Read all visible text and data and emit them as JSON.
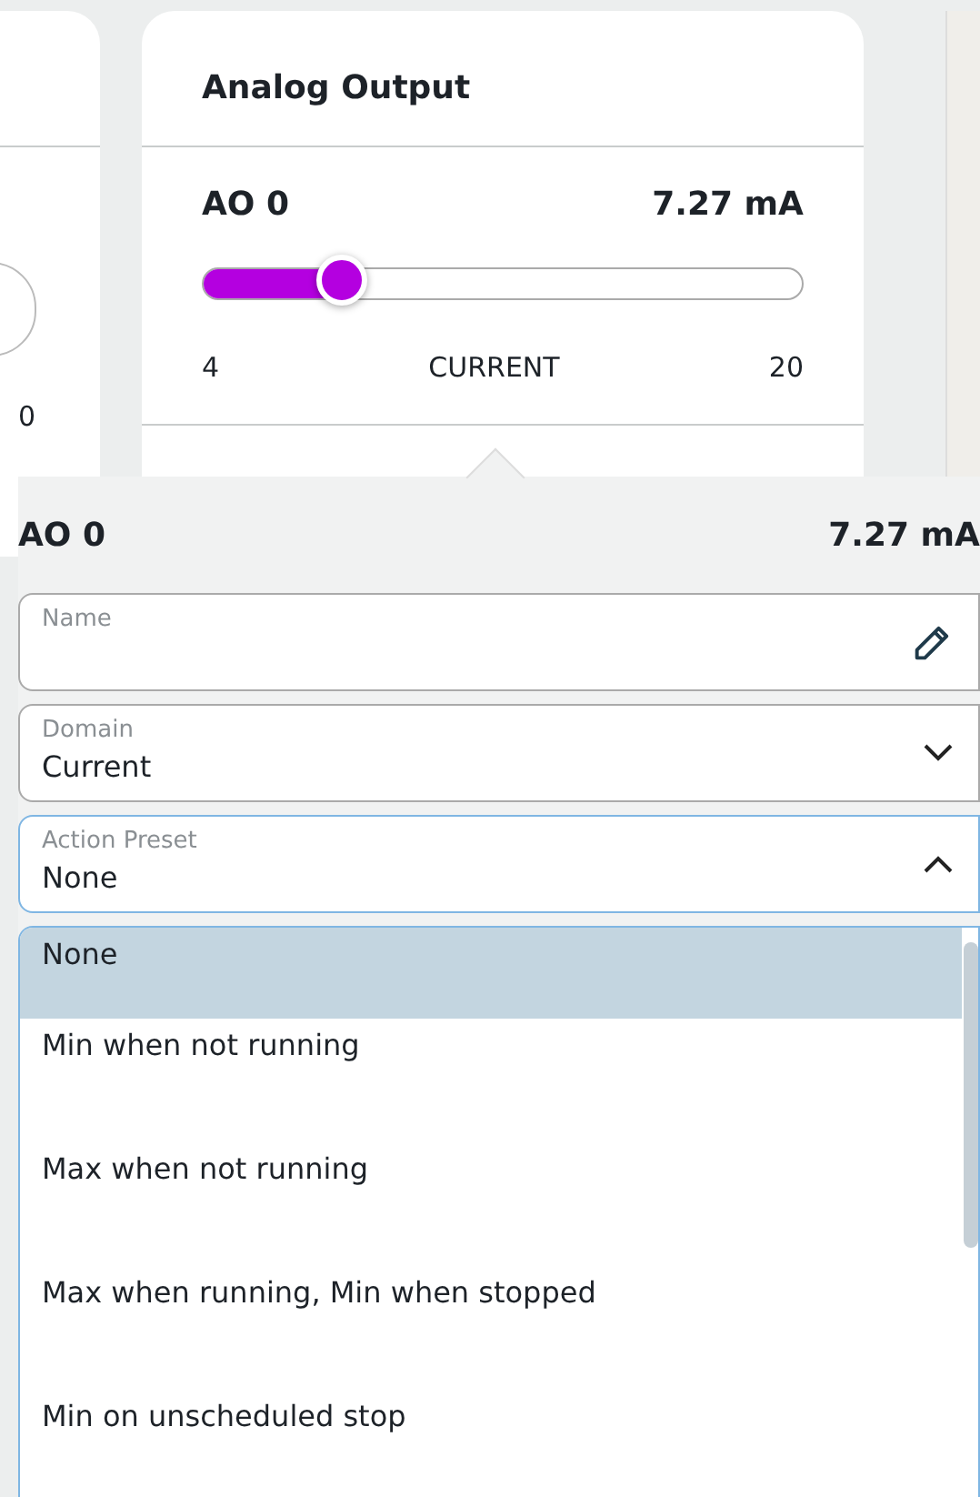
{
  "left_card": {
    "value": "0"
  },
  "card": {
    "title": "Analog Output",
    "channel": {
      "name": "AO 0",
      "reading": "7.27 mA",
      "level": 0.23,
      "min": "4",
      "domain": "CURRENT",
      "max": "20"
    }
  },
  "popup": {
    "name": "AO 0",
    "reading": "7.27 mA",
    "fields": [
      {
        "kind": "text",
        "label": "Name"
      },
      {
        "kind": "select",
        "label": "Domain",
        "value": "Current",
        "expanded": false
      },
      {
        "kind": "select",
        "label": "Action Preset",
        "value": "None",
        "expanded": true
      }
    ],
    "options": [
      {
        "label": "None",
        "selected": true
      },
      {
        "label": "Min when not running",
        "selected": false
      },
      {
        "label": "Max when not running",
        "selected": false
      },
      {
        "label": "Max when running, Min when stopped",
        "selected": false
      },
      {
        "label": "Min on unscheduled stop",
        "selected": false
      }
    ]
  }
}
